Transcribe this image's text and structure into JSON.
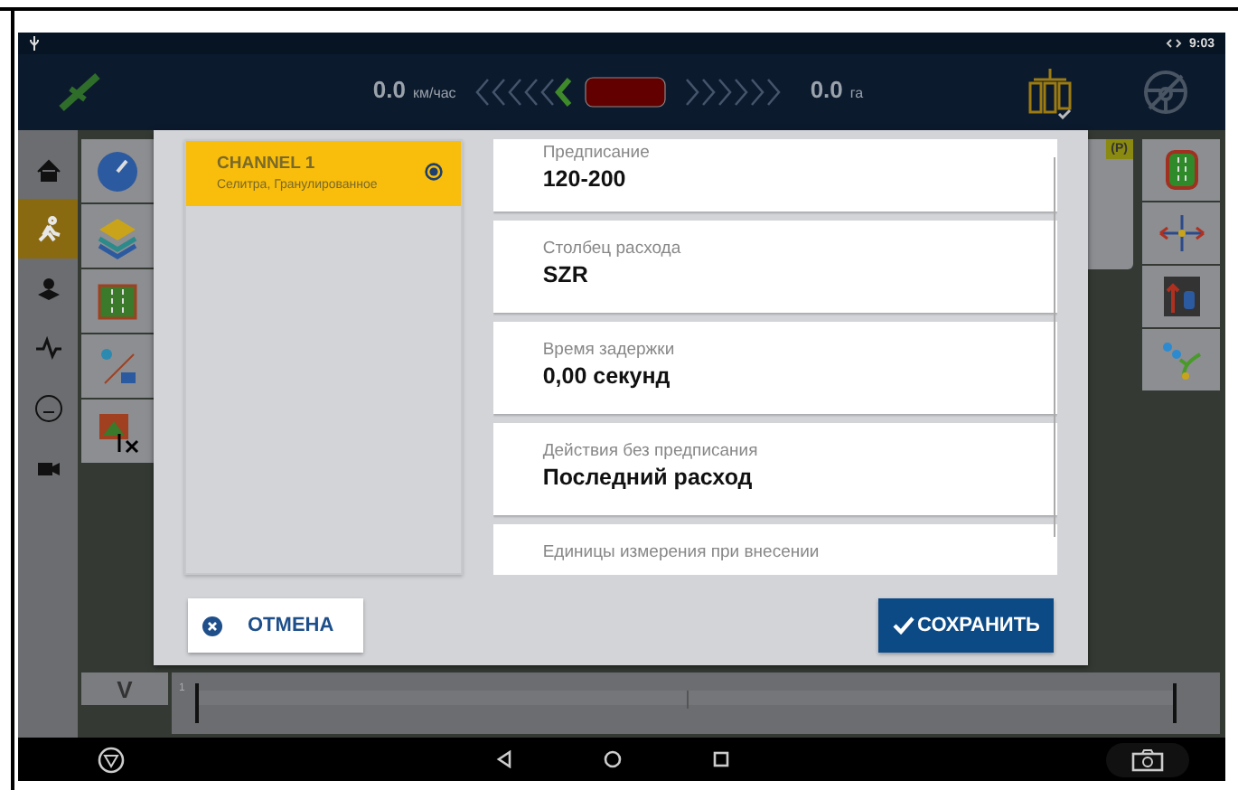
{
  "status_bar": {
    "time": "9:03"
  },
  "top_bar": {
    "speed": "0.0",
    "speed_unit": "км/час",
    "area": "0.0",
    "area_unit": "га"
  },
  "map": {
    "badge": "(P)",
    "scale_label": "1",
    "view_button": "V"
  },
  "dialog": {
    "channels": [
      {
        "title": "CHANNEL 1",
        "subtitle": "Селитра, Гранулированное",
        "selected": true
      }
    ],
    "settings": [
      {
        "label": "Предписание",
        "value": "120-200"
      },
      {
        "label": "Столбец расхода",
        "value": "SZR"
      },
      {
        "label": "Время задержки",
        "value": "0,00 секунд"
      },
      {
        "label": "Действия без предписания",
        "value": "Последний расход"
      },
      {
        "label": "Единицы измерения при внесении"
      }
    ],
    "buttons": [
      {
        "kind": "cancel",
        "label": "ОТМЕНА"
      },
      {
        "kind": "save",
        "label": "СОХРАНИТЬ"
      }
    ]
  }
}
